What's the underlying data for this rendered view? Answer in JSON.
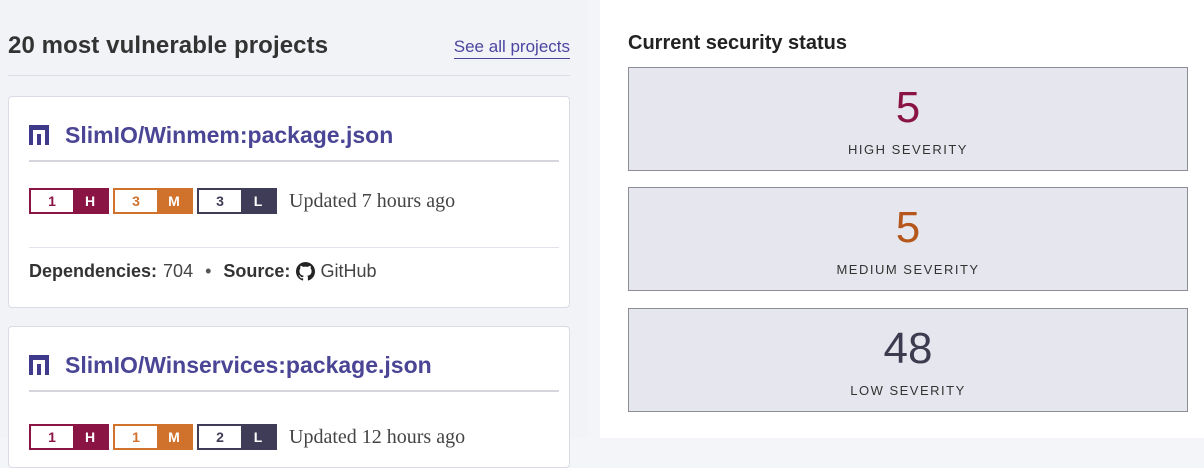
{
  "projects": {
    "title": "20 most vulnerable projects",
    "see_all_label": "See all projects",
    "items": [
      {
        "name": "SlimIO/Winmem:package.json",
        "high": "1",
        "high_label": "H",
        "medium": "3",
        "medium_label": "M",
        "low": "3",
        "low_label": "L",
        "updated": "Updated 7 hours ago",
        "dependencies_label": "Dependencies:",
        "dependencies": "704",
        "separator": "•",
        "source_label": "Source:",
        "source": "GitHub",
        "source_icon": "github-icon"
      },
      {
        "name": "SlimIO/Winservices:package.json",
        "high": "1",
        "high_label": "H",
        "medium": "1",
        "medium_label": "M",
        "low": "2",
        "low_label": "L",
        "updated": "Updated 12 hours ago"
      }
    ]
  },
  "security_status": {
    "title": "Current security status",
    "high": {
      "value": "5",
      "label": "HIGH SEVERITY",
      "color": "#8a1544"
    },
    "medium": {
      "value": "5",
      "label": "MEDIUM SEVERITY",
      "color": "#b5571c"
    },
    "low": {
      "value": "48",
      "label": "LOW SEVERITY",
      "color": "#3d3b4f"
    }
  },
  "colors": {
    "high": "#8a1544",
    "medium": "#d0722c",
    "low": "#3e3c56",
    "link": "#4a4595"
  }
}
